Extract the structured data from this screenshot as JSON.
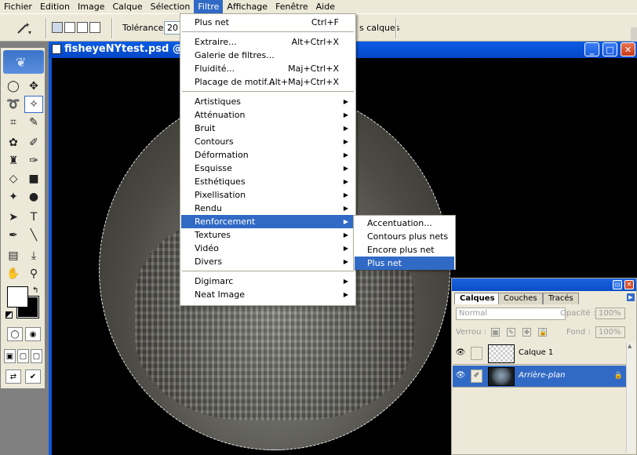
{
  "menubar": [
    "Fichier",
    "Edition",
    "Image",
    "Calque",
    "Sélection",
    "Filtre",
    "Affichage",
    "Fenêtre",
    "Aide"
  ],
  "menubar_active": "Filtre",
  "optionsbar": {
    "tolerance_label": "Tolérance :",
    "tolerance_value": "20",
    "all_layers_label": "s calques"
  },
  "document": {
    "title": "fisheyeNYtest.psd @ 10"
  },
  "filter_menu": {
    "top": [
      {
        "label": "Plus net",
        "shortcut": "Ctrl+F"
      }
    ],
    "group2": [
      {
        "label": "Extraire...",
        "shortcut": "Alt+Ctrl+X"
      },
      {
        "label": "Galerie de filtres...",
        "shortcut": ""
      },
      {
        "label": "Fluidité...",
        "shortcut": "Maj+Ctrl+X"
      },
      {
        "label": "Placage de motif...",
        "shortcut": "Alt+Maj+Ctrl+X"
      }
    ],
    "group3": [
      "Artistiques",
      "Atténuation",
      "Bruit",
      "Contours",
      "Déformation",
      "Esquisse",
      "Esthétiques",
      "Pixellisation",
      "Rendu",
      "Renforcement",
      "Textures",
      "Vidéo",
      "Divers"
    ],
    "group4": [
      "Digimarc",
      "Neat Image"
    ],
    "highlighted": "Renforcement"
  },
  "submenu": {
    "items": [
      "Accentuation...",
      "Contours plus nets",
      "Encore plus net",
      "Plus net"
    ],
    "highlighted": "Plus net"
  },
  "layers_panel": {
    "tabs": [
      "Calques",
      "Couches",
      "Tracés"
    ],
    "active_tab": "Calques",
    "blend_mode": "Normal",
    "opacity_label": "Opacité :",
    "opacity_value": "100%",
    "lock_label": "Verrou :",
    "fill_label": "Fond :",
    "fill_value": "100%",
    "layers": [
      {
        "name": "Calque 1",
        "selected": false
      },
      {
        "name": "Arrière-plan",
        "selected": true
      }
    ]
  },
  "colors": {
    "accent": "#316ac5",
    "titlebar": "#0a5ee6",
    "menubar_bg": "#ece9d8"
  }
}
